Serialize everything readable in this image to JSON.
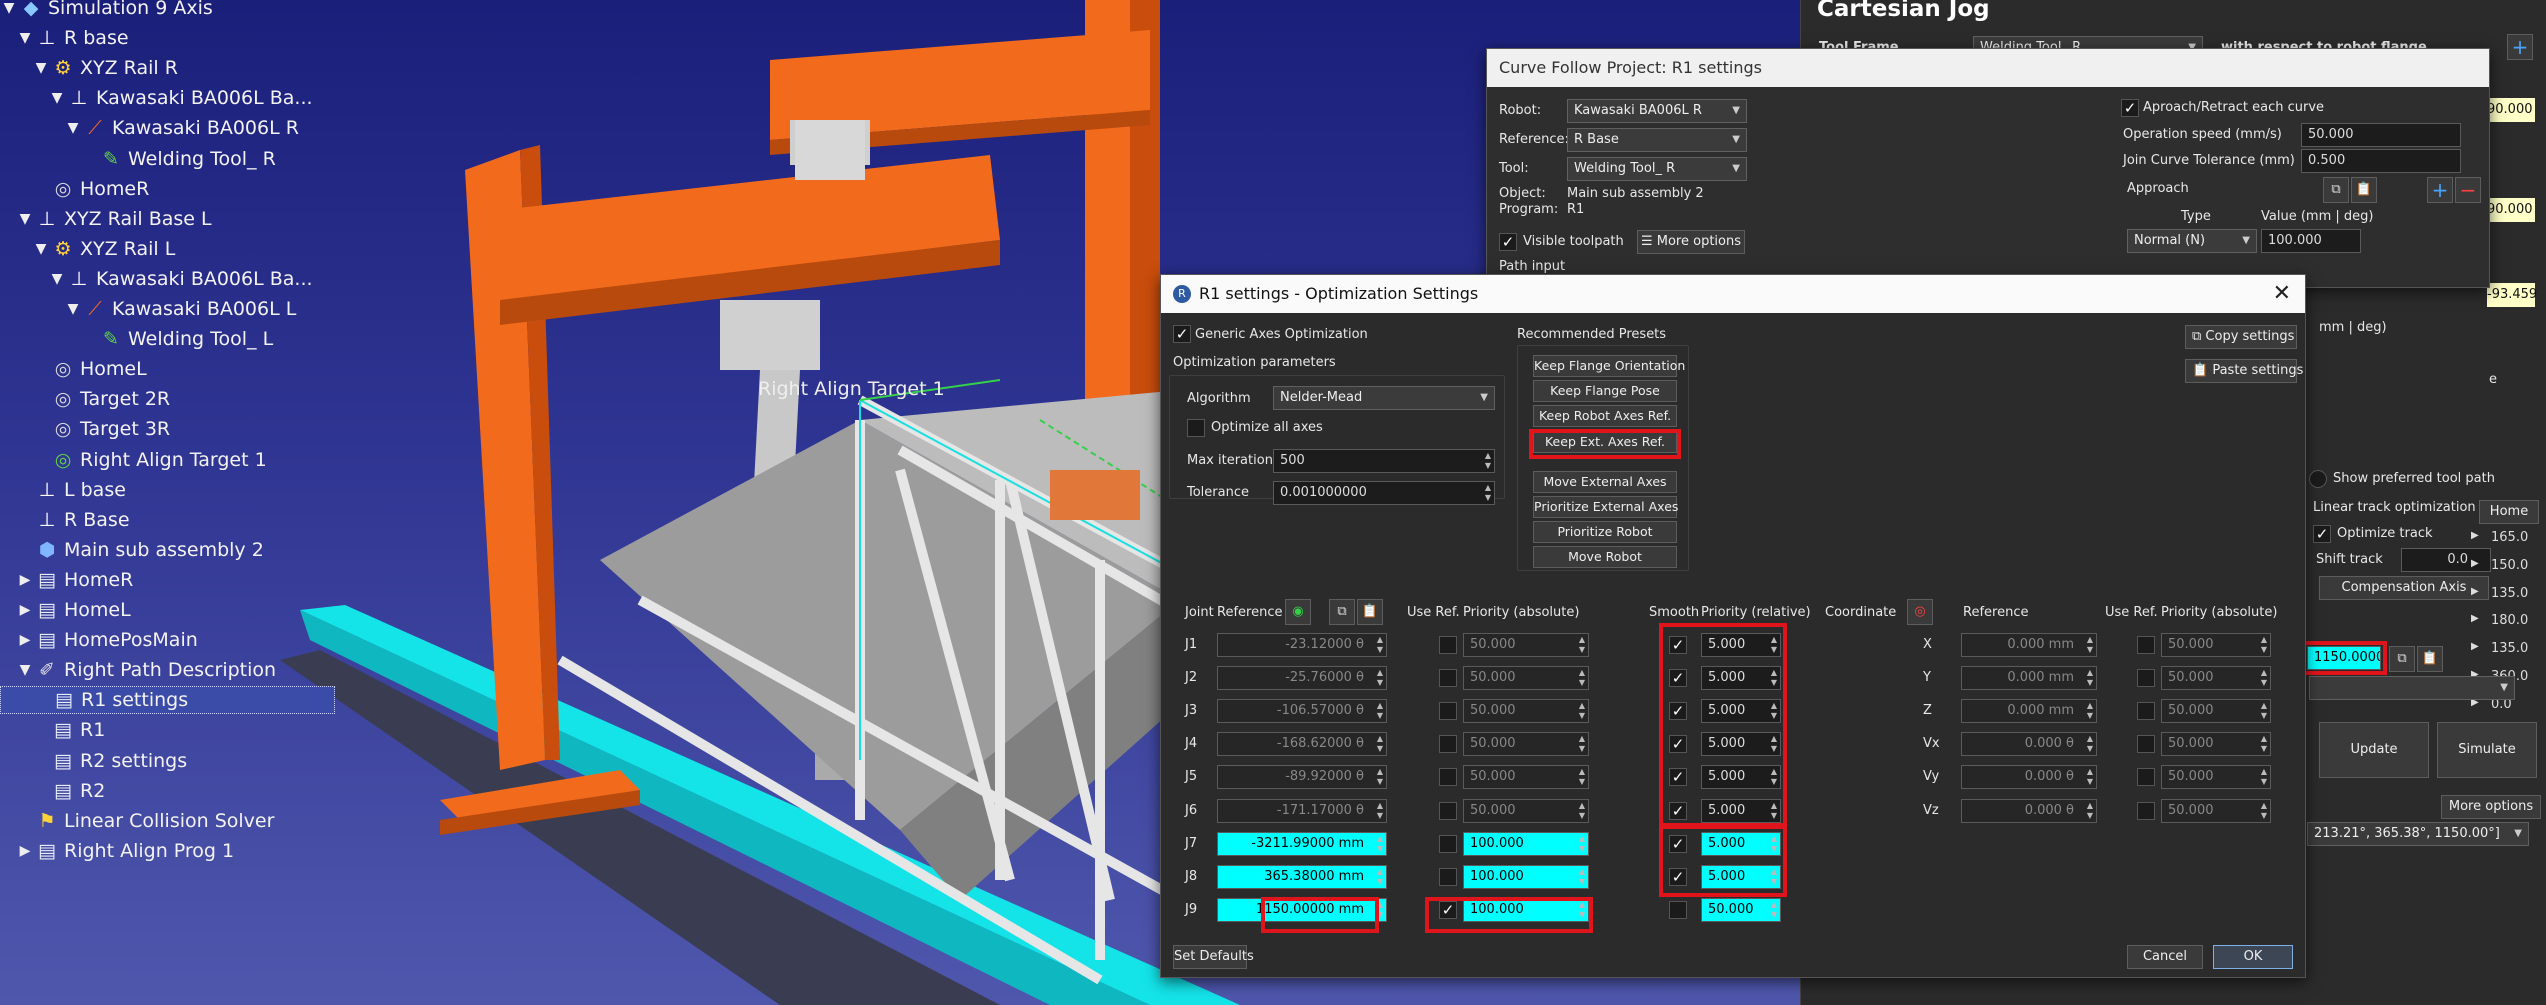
{
  "tree": {
    "items": [
      {
        "label": "Simulation 9 Axis",
        "icon": "station-icon"
      },
      {
        "label": "R base",
        "icon": "frame-icon"
      },
      {
        "label": "XYZ Rail R",
        "icon": "mechanism-icon"
      },
      {
        "label": "Kawasaki BA006L Ba...",
        "icon": "frame-icon"
      },
      {
        "label": "Kawasaki BA006L R",
        "icon": "robot-icon"
      },
      {
        "label": "Welding Tool_ R",
        "icon": "tool-icon"
      },
      {
        "label": "HomeR",
        "icon": "target-icon"
      },
      {
        "label": "XYZ Rail  Base L",
        "icon": "frame-icon"
      },
      {
        "label": "XYZ Rail L",
        "icon": "mechanism-icon"
      },
      {
        "label": "Kawasaki BA006L Ba...",
        "icon": "frame-icon"
      },
      {
        "label": "Kawasaki BA006L L",
        "icon": "robot-icon"
      },
      {
        "label": "Welding Tool_ L",
        "icon": "tool-icon"
      },
      {
        "label": "HomeL",
        "icon": "target-icon"
      },
      {
        "label": "Target 2R",
        "icon": "target-icon"
      },
      {
        "label": "Target 3R",
        "icon": "target-icon"
      },
      {
        "label": "Right Align Target 1",
        "icon": "target-green-icon"
      },
      {
        "label": "L base",
        "icon": "frame-icon"
      },
      {
        "label": "R Base",
        "icon": "frame-icon"
      },
      {
        "label": "Main sub assembly 2",
        "icon": "object-icon"
      },
      {
        "label": "HomeR",
        "icon": "program-icon"
      },
      {
        "label": "HomeL",
        "icon": "program-icon"
      },
      {
        "label": "HomePosMain",
        "icon": "program-icon"
      },
      {
        "label": "Right Path Description",
        "icon": "curve-icon"
      },
      {
        "label": "R1 settings",
        "icon": "settings-icon"
      },
      {
        "label": "R1",
        "icon": "program-icon"
      },
      {
        "label": "R2 settings",
        "icon": "settings-icon"
      },
      {
        "label": "R2",
        "icon": "program-icon"
      },
      {
        "label": "Linear Collision Solver",
        "icon": "python-icon"
      },
      {
        "label": "Right Align Prog 1",
        "icon": "program-icon"
      }
    ]
  },
  "viewport": {
    "target_label": "Right Align Target 1"
  },
  "cartesian_jog": {
    "title": "Cartesian Jog",
    "tool_frame_label": "Tool Frame",
    "tool_frame_value": "Welding Tool_ R",
    "respect_label": "with respect to robot flange",
    "side_values": [
      "90.000",
      "90.000",
      "-93.459"
    ],
    "partial_labels": [
      "mm | deg)",
      "e"
    ],
    "show_preferred": "Show preferred tool path",
    "linear_track": "Linear track optimization",
    "optimize_track": "Optimize track",
    "shift_track_label": "Shift track",
    "shift_track_value": "0.0",
    "compensation_axis": "Compensation Axis",
    "home_btn": "Home",
    "joint_values": [
      "165.0",
      "150.0",
      "135.0",
      "180.0",
      "135.0",
      "360.0",
      "0.0",
      "1150.0",
      "1150.0"
    ],
    "highlight_value": "1150.0000",
    "update": "Update",
    "simulate": "Simulate",
    "more_options": "More options",
    "coords_text": "213.21°,  365.38°, 1150.00°]"
  },
  "curve_follow": {
    "title": "Curve Follow Project: R1 settings",
    "robot_label": "Robot:",
    "robot_value": "Kawasaki BA006L R",
    "reference_label": "Reference:",
    "reference_value": "R Base",
    "tool_label": "Tool:",
    "tool_value": "Welding Tool_ R",
    "object_label": "Object:",
    "object_value": "Main sub assembly 2",
    "program_label": "Program:",
    "program_value": "R1",
    "visible_toolpath": "Visible toolpath",
    "more_options": "More options",
    "path_input": "Path input",
    "approach_retract": "Aproach/Retract each curve",
    "op_speed_label": "Operation speed (mm/s)",
    "op_speed_value": "50.000",
    "join_tol_label": "Join Curve Tolerance (mm)",
    "join_tol_value": "0.500",
    "approach_label": "Approach",
    "col_type": "Type",
    "col_value": "Value (mm | deg)",
    "row_type": "Normal (N)",
    "row_value": "100.000"
  },
  "opt": {
    "title": "R1 settings - Optimization Settings",
    "generic": "Generic Axes Optimization",
    "params": "Optimization parameters",
    "algorithm_label": "Algorithm",
    "algorithm_value": "Nelder-Mead",
    "optimize_all": "Optimize all axes",
    "max_iter_label": "Max iterations",
    "max_iter_value": "500",
    "tolerance_label": "Tolerance",
    "tolerance_value": "0.001000000",
    "presets_label": "Recommended Presets",
    "presets": [
      "Keep Flange Orientation",
      "Keep Flange Pose",
      "Keep Robot Axes Ref.",
      "Keep Ext. Axes Ref.",
      "Move External Axes",
      "Prioritize External Axes",
      "Prioritize Robot",
      "Move Robot"
    ],
    "copy": "Copy settings",
    "paste": "Paste settings",
    "hdr": {
      "joint": "Joint",
      "reference": "Reference",
      "use_ref": "Use Ref.",
      "priority_abs": "Priority (absolute)",
      "smooth": "Smooth",
      "priority_rel": "Priority (relative)",
      "coordinate": "Coordinate",
      "reference2": "Reference",
      "use_ref2": "Use Ref.",
      "priority_abs2": "Priority (absolute)"
    },
    "joints": [
      {
        "name": "J1",
        "ref": "-23.12000 θ",
        "useref": false,
        "prio_abs": "50.000",
        "smooth": true,
        "prio_rel": "5.000"
      },
      {
        "name": "J2",
        "ref": "-25.76000 θ",
        "useref": false,
        "prio_abs": "50.000",
        "smooth": true,
        "prio_rel": "5.000"
      },
      {
        "name": "J3",
        "ref": "-106.57000 θ",
        "useref": false,
        "prio_abs": "50.000",
        "smooth": true,
        "prio_rel": "5.000"
      },
      {
        "name": "J4",
        "ref": "-168.62000 θ",
        "useref": false,
        "prio_abs": "50.000",
        "smooth": true,
        "prio_rel": "5.000"
      },
      {
        "name": "J5",
        "ref": "-89.92000 θ",
        "useref": false,
        "prio_abs": "50.000",
        "smooth": true,
        "prio_rel": "5.000"
      },
      {
        "name": "J6",
        "ref": "-171.17000 θ",
        "useref": false,
        "prio_abs": "50.000",
        "smooth": true,
        "prio_rel": "5.000"
      },
      {
        "name": "J7",
        "ref": "-3211.99000 mm",
        "useref": false,
        "prio_abs": "100.000",
        "smooth": true,
        "prio_rel": "5.000"
      },
      {
        "name": "J8",
        "ref": "365.38000 mm",
        "useref": false,
        "prio_abs": "100.000",
        "smooth": true,
        "prio_rel": "5.000"
      },
      {
        "name": "J9",
        "ref": "1150.00000 mm",
        "useref": true,
        "prio_abs": "100.000",
        "smooth": false,
        "prio_rel": "50.000"
      }
    ],
    "coords": [
      {
        "name": "X",
        "ref": "0.000 mm",
        "prio_abs": "50.000"
      },
      {
        "name": "Y",
        "ref": "0.000 mm",
        "prio_abs": "50.000"
      },
      {
        "name": "Z",
        "ref": "0.000 mm",
        "prio_abs": "50.000"
      },
      {
        "name": "Vx",
        "ref": "0.000 θ",
        "prio_abs": "50.000"
      },
      {
        "name": "Vy",
        "ref": "0.000 θ",
        "prio_abs": "50.000"
      },
      {
        "name": "Vz",
        "ref": "0.000 θ",
        "prio_abs": "50.000"
      }
    ],
    "set_defaults": "Set Defaults",
    "cancel": "Cancel",
    "ok": "OK"
  },
  "colors": {
    "highlight": "#e0151b",
    "cyan": "#00ffff",
    "orange": "#f26a1b"
  }
}
